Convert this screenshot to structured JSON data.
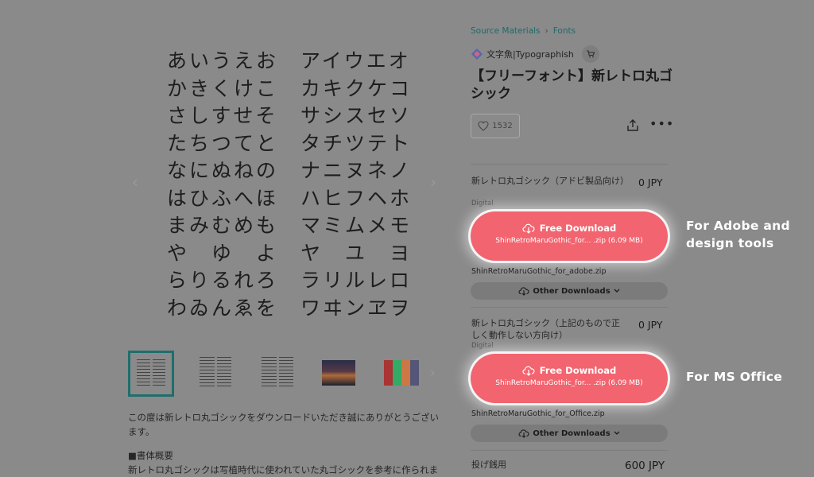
{
  "preview": {
    "rows": [
      {
        "hira": "あいうえお",
        "kata": "アイウエオ"
      },
      {
        "hira": "かきくけこ",
        "kata": "カキクケコ"
      },
      {
        "hira": "さしすせそ",
        "kata": "サシスセソ"
      },
      {
        "hira": "たちつてと",
        "kata": "タチツテト"
      },
      {
        "hira": "なにぬねの",
        "kata": "ナニヌネノ"
      },
      {
        "hira": "はひふへほ",
        "kata": "ハヒフヘホ"
      },
      {
        "hira": "まみむめも",
        "kata": "マミムメモ"
      },
      {
        "hira": "や　ゆ　よ",
        "kata": "ヤ　ユ　ヨ"
      },
      {
        "hira": "らりるれろ",
        "kata": "ラリルレロ"
      },
      {
        "hira": "わゐんゑを",
        "kata": "ワヰンヱヲ"
      }
    ],
    "prev_glyph": "‹",
    "next_glyph": "›"
  },
  "description": {
    "line1": "この度は新レトロ丸ゴシックをダウンロードいただき誠にありがとうございます。",
    "heading": "■書体概要",
    "line2": "新レトロ丸ゴシックは写植時代に使われていた丸ゴシックを参考に作られま"
  },
  "breadcrumb": {
    "parent": "Source Materials",
    "separator": "›",
    "current": "Fonts"
  },
  "shop": {
    "name": "文字魚|Typographish"
  },
  "product": {
    "title": "【フリーフォント】新レトロ丸ゴシック",
    "likes": "1532",
    "more": "•••"
  },
  "items": [
    {
      "name": "新レトロ丸ゴシック（アドビ製品向け）",
      "kind": "Digital",
      "price": "0 JPY",
      "button_label": "Free Download",
      "button_sub": "ShinRetroMaruGothic_for... .zip (6.09 MB)",
      "filename": "ShinRetroMaruGothic_for_adobe.zip",
      "other": "Other Downloads"
    },
    {
      "name": "新レトロ丸ゴシック（上記のもので正しく動作しない方向け）",
      "kind": "Digital",
      "price": "0 JPY",
      "button_label": "Free Download",
      "button_sub": "ShinRetroMaruGothic_for... .zip (6.09 MB)",
      "filename": "ShinRetroMaruGothic_for_Office.zip",
      "other": "Other Downloads"
    },
    {
      "name": "投げ銭用",
      "price": "600 JPY"
    }
  ],
  "annotations": {
    "adobe_line1": "For Adobe and",
    "adobe_line2": "design tools",
    "office": "For MS Office"
  },
  "colors": {
    "accent": "#f2646f",
    "link": "#1d6b69",
    "overlay": "#8a8a8a"
  }
}
